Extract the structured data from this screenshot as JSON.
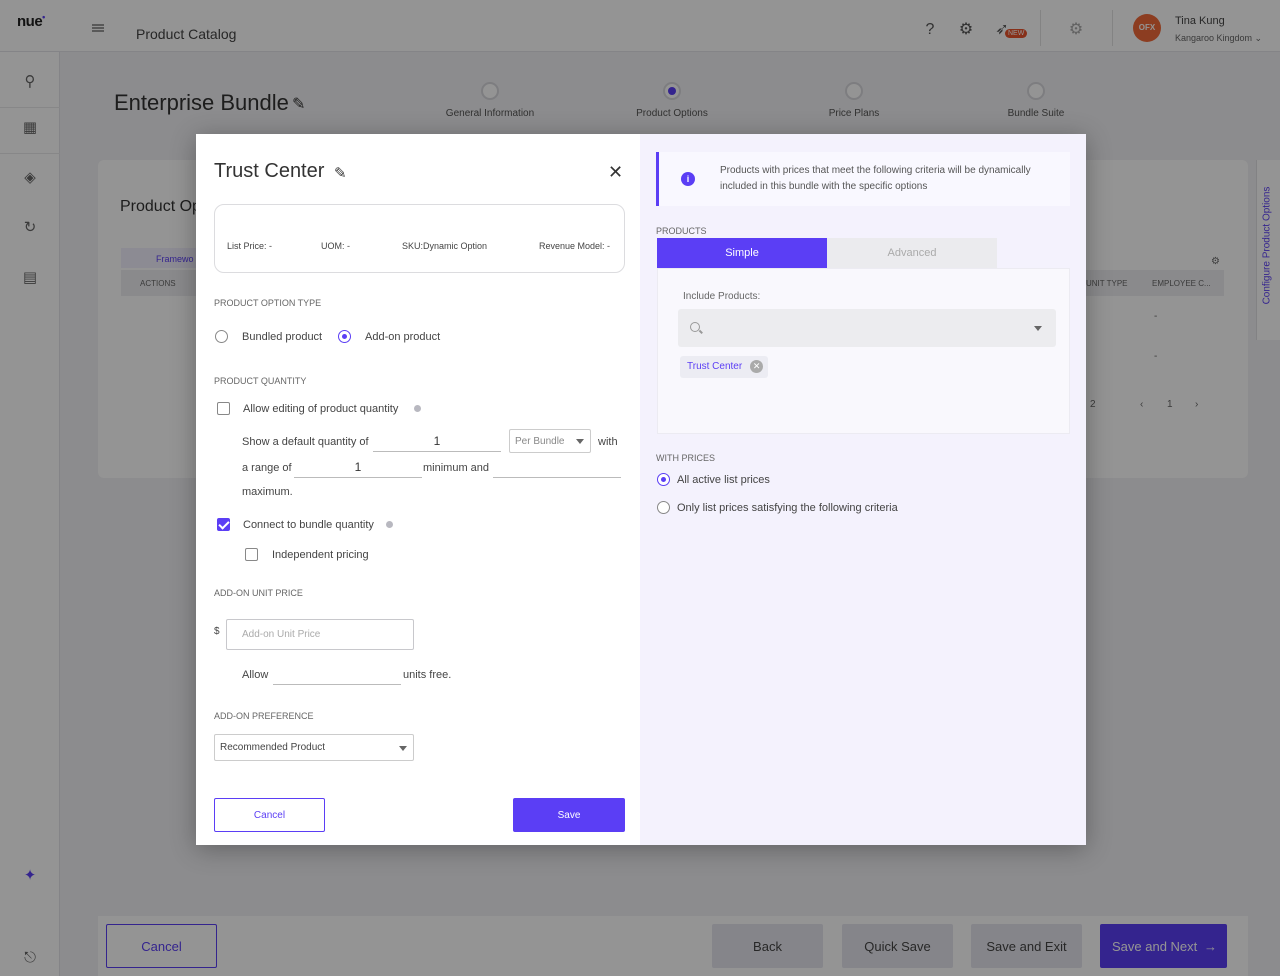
{
  "app": {
    "logo": "nue",
    "logo_mark": "•",
    "title": "Product Catalog",
    "new_badge": "NEW",
    "user_initials": "OFX",
    "user_name": "Tina Kung",
    "user_org": "Kangaroo Kingdom ⌄"
  },
  "page": {
    "bundle_title": "Enterprise Bundle",
    "steps": [
      {
        "label": "General Information",
        "active": false
      },
      {
        "label": "Product Options",
        "active": true
      },
      {
        "label": "Price Plans",
        "active": false
      },
      {
        "label": "Bundle Suite",
        "active": false
      }
    ],
    "section_partial": "Product Op",
    "framework_partial": "Framewo",
    "actions_header": "ACTIONS",
    "unit_type_header": "UNIT TYPE",
    "employee_header": "EMPLOYEE C...",
    "dash": "-",
    "page_count_partial": "2",
    "page_number": "1",
    "side_tab_label": "Configure Product Options"
  },
  "footer": {
    "cancel": "Cancel",
    "back": "Back",
    "quick_save": "Quick Save",
    "save_exit": "Save and Exit",
    "save_next": "Save and Next"
  },
  "modal": {
    "title": "Trust Center",
    "info": {
      "list_price": "List Price: -",
      "uom": "UOM: -",
      "sku": "SKU:Dynamic Option",
      "revenue_model": "Revenue Model: -"
    },
    "option_type_label": "PRODUCT OPTION TYPE",
    "bundled_label": "Bundled product",
    "addon_label": "Add-on product",
    "quantity_label": "PRODUCT QUANTITY",
    "allow_edit_label": "Allow editing of product quantity",
    "show_default_label": "Show a default quantity of",
    "default_qty": "1",
    "per_bundle": "Per Bundle",
    "with_label": "with",
    "range_of_label": "a range of",
    "range_min": "1",
    "minimum_and_label": "minimum and",
    "range_max": "",
    "maximum_label": "maximum.",
    "connect_label": "Connect to bundle quantity",
    "independent_label": "Independent pricing",
    "unit_price_label": "ADD-ON UNIT PRICE",
    "currency": "$",
    "unit_price_placeholder": "Add-on Unit Price",
    "allow_label": "Allow",
    "free_units": "",
    "units_free_label": "units free.",
    "preference_label": "ADD-ON PREFERENCE",
    "preference_value": "Recommended Product",
    "cancel": "Cancel",
    "save": "Save",
    "right": {
      "notice": "Products with prices that meet the following criteria will be dynamically included in this bundle with the specific options",
      "notice_icon": "i",
      "products_label": "PRODUCTS",
      "tab_simple": "Simple",
      "tab_advanced": "Advanced",
      "include_label": "Include Products:",
      "chip": "Trust Center",
      "with_prices_label": "WITH PRICES",
      "all_prices": "All active list prices",
      "only_prices": "Only list prices satisfying the following criteria"
    }
  },
  "colors": {
    "accent": "#5b3ef5",
    "overlay": "rgba(0,0,0,0.42)"
  }
}
